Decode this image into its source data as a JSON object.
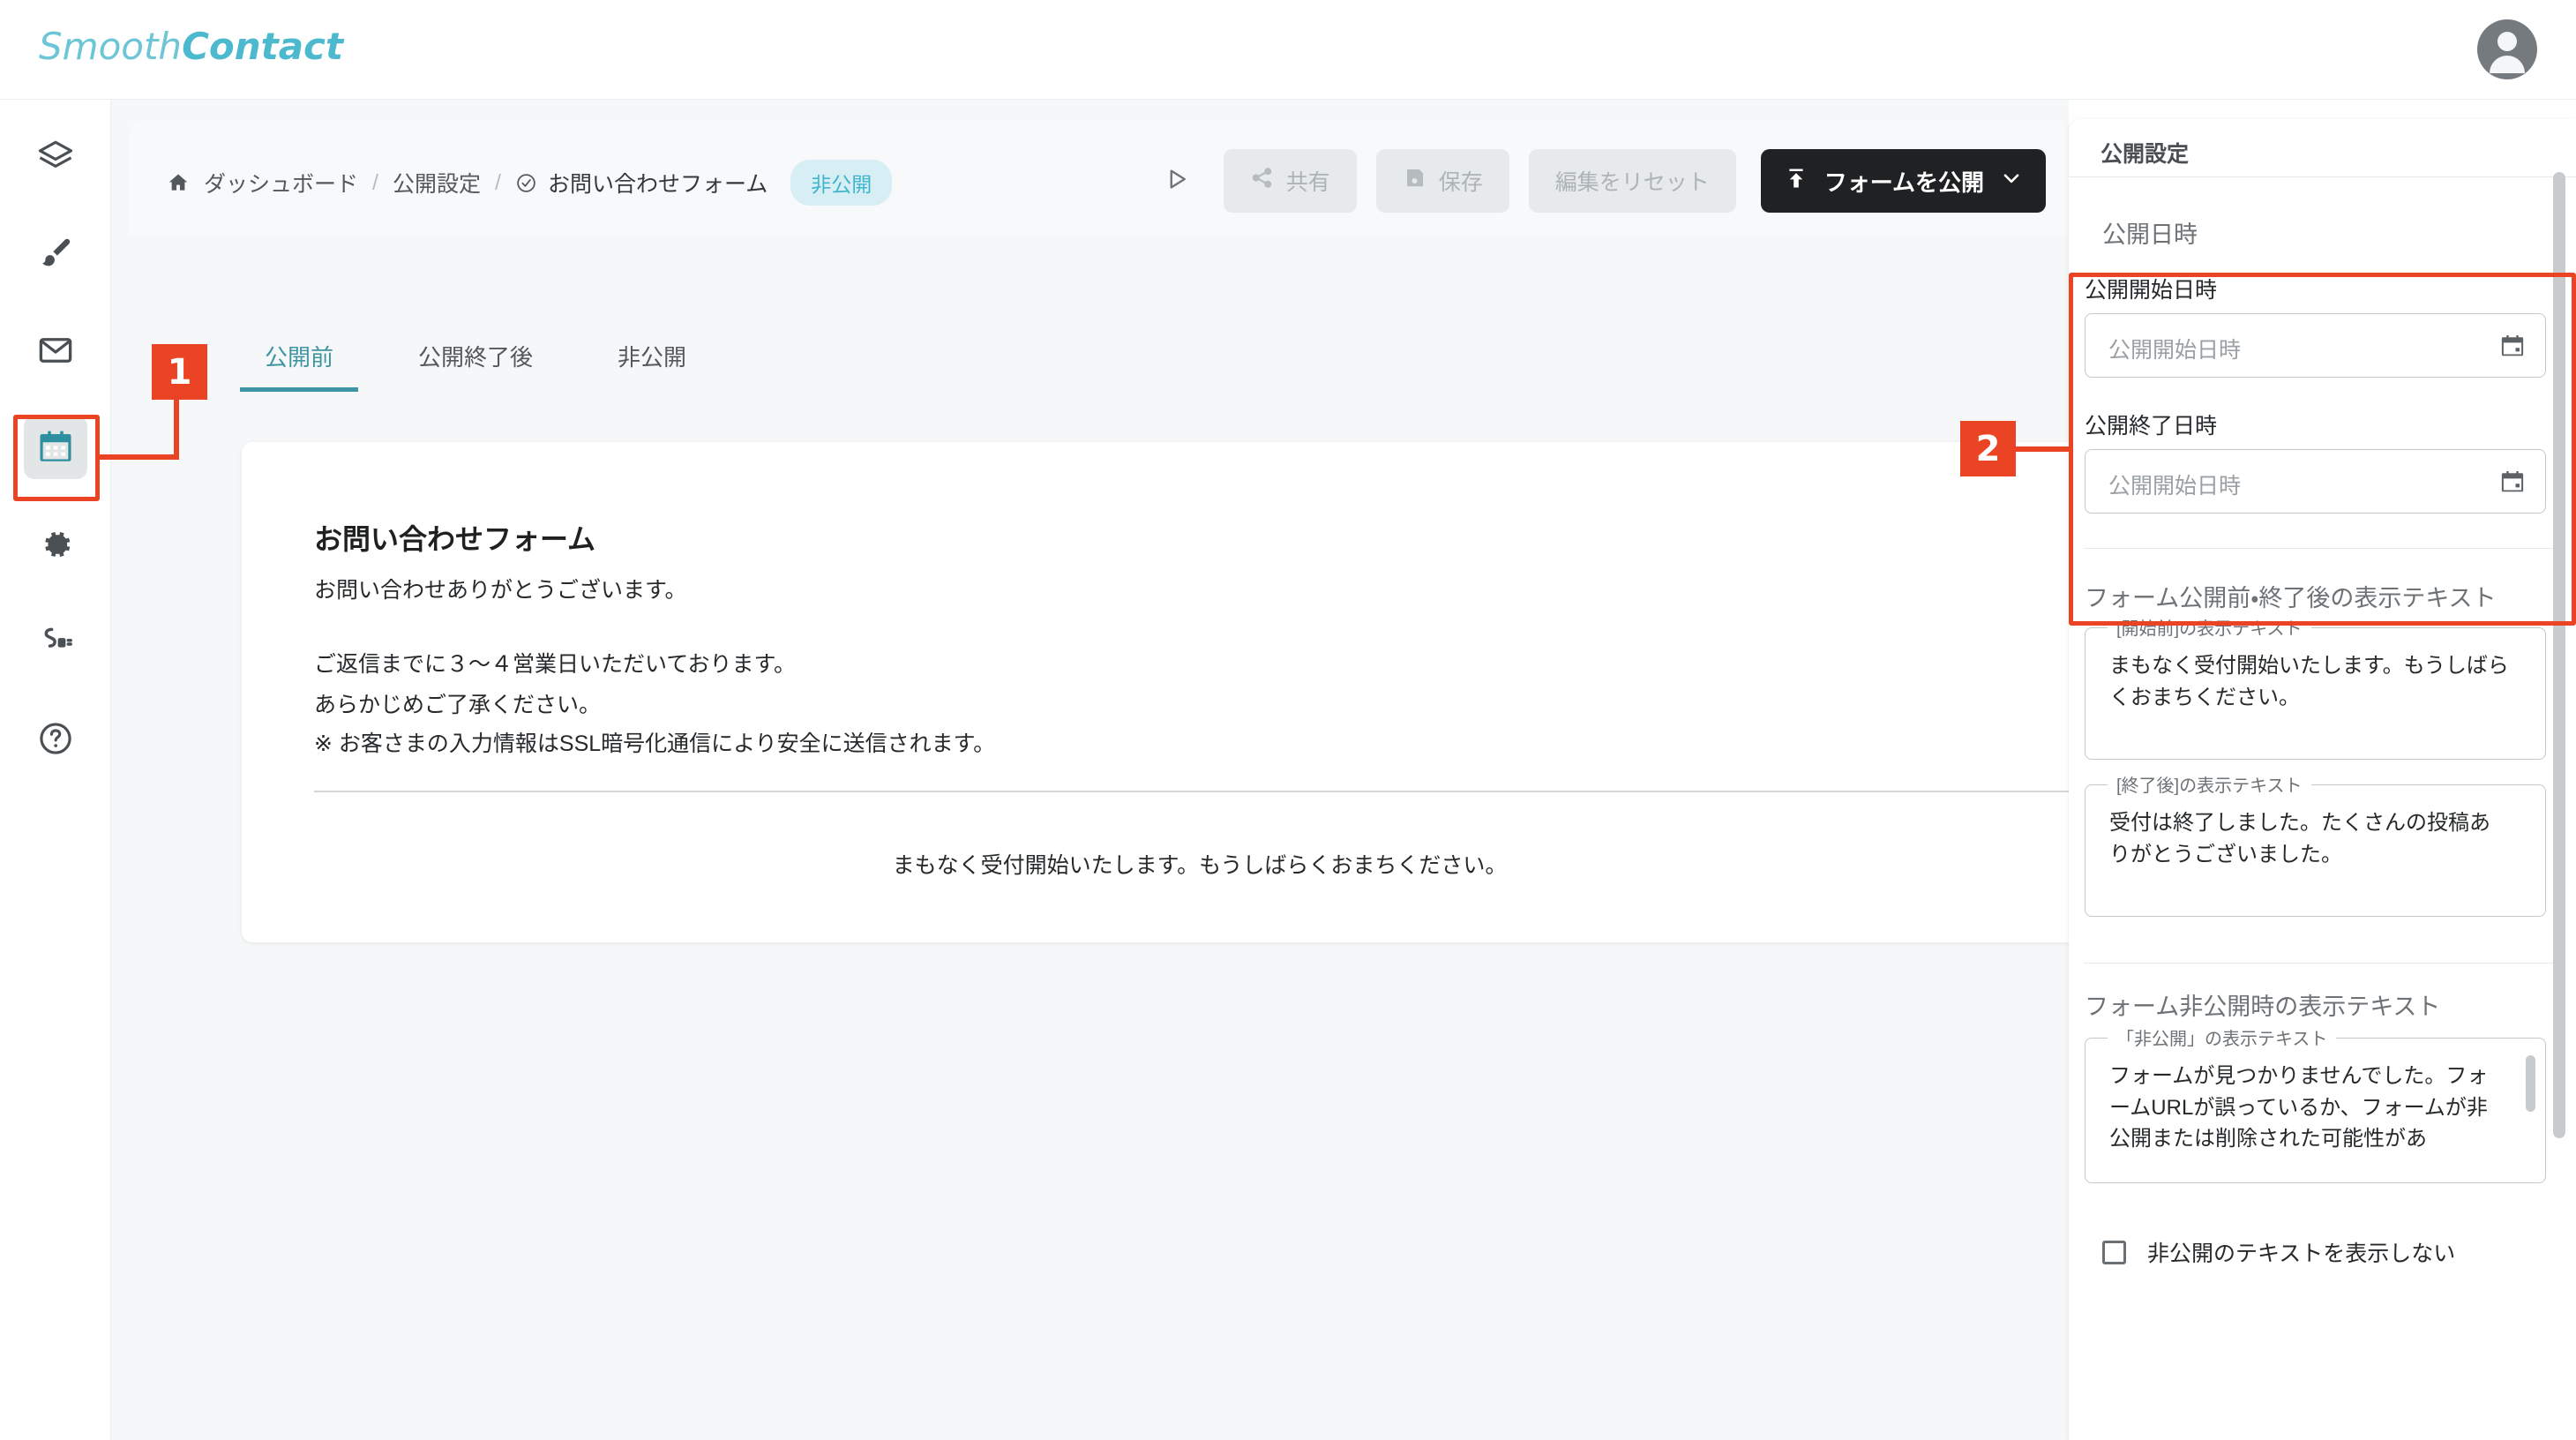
{
  "app": {
    "logo_light": "Smooth",
    "logo_bold": "Contact",
    "avatar_icon": "account-circle-icon",
    "accent_teal": "#3f95a3",
    "annotation_red": "#ea4424"
  },
  "sidebar": {
    "items": [
      {
        "icon": "layers-icon",
        "name": "layers",
        "active": false
      },
      {
        "icon": "brush-icon",
        "name": "design",
        "active": false
      },
      {
        "icon": "mail-icon",
        "name": "mail",
        "active": false
      },
      {
        "icon": "calendar-icon",
        "name": "publish-settings",
        "active": true
      },
      {
        "icon": "gear-icon",
        "name": "settings",
        "active": false
      },
      {
        "icon": "plug-icon",
        "name": "integrations",
        "active": false
      },
      {
        "icon": "help-circle-icon",
        "name": "help",
        "active": false
      }
    ]
  },
  "breadcrumb": {
    "home_icon": "home-icon",
    "dashboard": "ダッシュボード",
    "separator": "/",
    "settings": "公開設定",
    "current_icon": "check-circle-icon",
    "current": "お問い合わせフォーム",
    "status_badge": "非公開"
  },
  "toolbar": {
    "preview_icon": "play-icon",
    "share_label": "共有",
    "share_icon": "share-icon",
    "save_label": "保存",
    "save_icon": "save-icon",
    "reset_label": "編集をリセット",
    "publish_label": "フォームを公開",
    "publish_icon": "publish-upload-icon",
    "publish_chevron": "chevron-down-icon"
  },
  "tabs": [
    {
      "label": "公開前",
      "active": true
    },
    {
      "label": "公開終了後",
      "active": false
    },
    {
      "label": "非公開",
      "active": false
    }
  ],
  "form_preview": {
    "title": "お問い合わせフォーム",
    "line1": "お問い合わせありがとうございます。",
    "line2": "ご返信までに３〜４営業日いただいております。",
    "line3": "あらかじめご了承ください。",
    "line4": "※ お客さまの入力情報はSSL暗号化通信により安全に送信されます。",
    "center_message": "まもなく受付開始いたします。もうしばらくおまちください。"
  },
  "right_panel": {
    "header": "公開設定",
    "section_datetime_label": "公開日時",
    "start_field": {
      "label": "公開開始日時",
      "placeholder": "公開開始日時",
      "value": "",
      "calendar_icon": "calendar-icon"
    },
    "end_field": {
      "label": "公開終了日時",
      "placeholder": "公開開始日時",
      "value": "",
      "calendar_icon": "calendar-icon"
    },
    "section_prepost_label": "フォーム公開前・終了後の表示テキスト",
    "before_textarea": {
      "legend": "[開始前]の表示テキスト",
      "value": "まもなく受付開始いたします。もうしばらくおまちください。"
    },
    "after_textarea": {
      "legend": "[終了後]の表示テキスト",
      "value": "受付は終了しました。たくさんの投稿ありがとうございました。"
    },
    "section_private_label": "フォーム非公開時の表示テキスト",
    "private_textarea": {
      "legend": "「非公開」の表示テキスト",
      "value": "フォームが見つかりませんでした。フォームURLが誤っているか、フォームが非公開または削除された可能性があ"
    },
    "hide_private_checkbox": {
      "label": "非公開のテキストを表示しない",
      "checked": false
    }
  },
  "annotations": [
    {
      "number": "1",
      "target": "sidebar-calendar-item"
    },
    {
      "number": "2",
      "target": "publish-datetime-group"
    }
  ]
}
